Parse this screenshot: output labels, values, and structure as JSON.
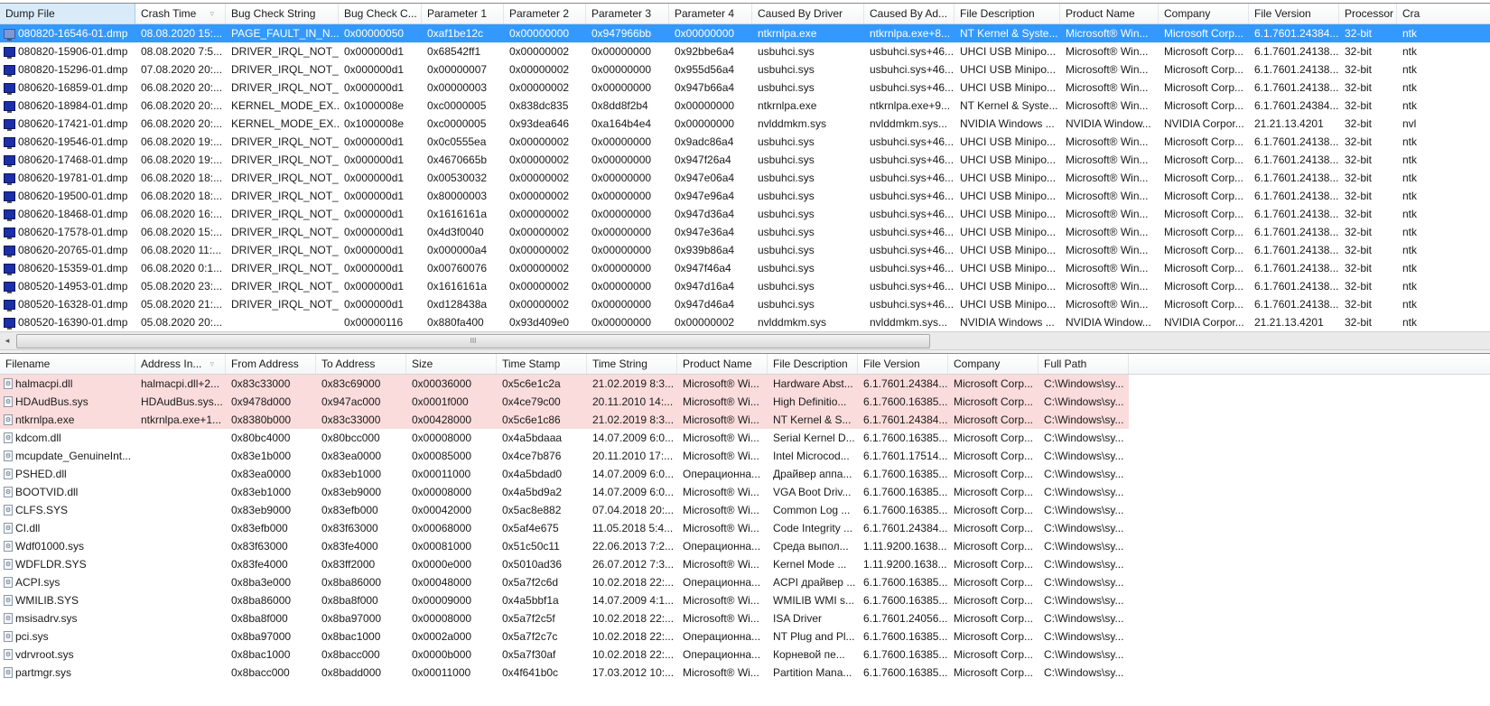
{
  "top": {
    "sort_column": "Crash Time",
    "columns": [
      "Dump File",
      "Crash Time",
      "Bug Check String",
      "Bug Check C...",
      "Parameter 1",
      "Parameter 2",
      "Parameter 3",
      "Parameter 4",
      "Caused By Driver",
      "Caused By Ad...",
      "File Description",
      "Product Name",
      "Company",
      "File Version",
      "Processor",
      "Cra"
    ],
    "selected_index": 0,
    "rows": [
      [
        "080820-16546-01.dmp",
        "08.08.2020 15:...",
        "PAGE_FAULT_IN_N...",
        "0x00000050",
        "0xaf1be12c",
        "0x00000000",
        "0x947966bb",
        "0x00000000",
        "ntkrnlpa.exe",
        "ntkrnlpa.exe+8...",
        "NT Kernel & Syste...",
        "Microsoft® Win...",
        "Microsoft Corp...",
        "6.1.7601.24384...",
        "32-bit",
        "ntk"
      ],
      [
        "080820-15906-01.dmp",
        "08.08.2020 7:5...",
        "DRIVER_IRQL_NOT_...",
        "0x000000d1",
        "0x68542ff1",
        "0x00000002",
        "0x00000000",
        "0x92bbe6a4",
        "usbuhci.sys",
        "usbuhci.sys+46...",
        "UHCI USB Minipo...",
        "Microsoft® Win...",
        "Microsoft Corp...",
        "6.1.7601.24138...",
        "32-bit",
        "ntk"
      ],
      [
        "080820-15296-01.dmp",
        "07.08.2020 20:...",
        "DRIVER_IRQL_NOT_...",
        "0x000000d1",
        "0x00000007",
        "0x00000002",
        "0x00000000",
        "0x955d56a4",
        "usbuhci.sys",
        "usbuhci.sys+46...",
        "UHCI USB Minipo...",
        "Microsoft® Win...",
        "Microsoft Corp...",
        "6.1.7601.24138...",
        "32-bit",
        "ntk"
      ],
      [
        "080620-16859-01.dmp",
        "06.08.2020 20:...",
        "DRIVER_IRQL_NOT_...",
        "0x000000d1",
        "0x00000003",
        "0x00000002",
        "0x00000000",
        "0x947b66a4",
        "usbuhci.sys",
        "usbuhci.sys+46...",
        "UHCI USB Minipo...",
        "Microsoft® Win...",
        "Microsoft Corp...",
        "6.1.7601.24138...",
        "32-bit",
        "ntk"
      ],
      [
        "080620-18984-01.dmp",
        "06.08.2020 20:...",
        "KERNEL_MODE_EX...",
        "0x1000008e",
        "0xc0000005",
        "0x838dc835",
        "0x8dd8f2b4",
        "0x00000000",
        "ntkrnlpa.exe",
        "ntkrnlpa.exe+9...",
        "NT Kernel & Syste...",
        "Microsoft® Win...",
        "Microsoft Corp...",
        "6.1.7601.24384...",
        "32-bit",
        "ntk"
      ],
      [
        "080620-17421-01.dmp",
        "06.08.2020 20:...",
        "KERNEL_MODE_EX...",
        "0x1000008e",
        "0xc0000005",
        "0x93dea646",
        "0xa164b4e4",
        "0x00000000",
        "nvlddmkm.sys",
        "nvlddmkm.sys...",
        "NVIDIA Windows ...",
        "NVIDIA Window...",
        "NVIDIA Corpor...",
        "21.21.13.4201",
        "32-bit",
        "nvl"
      ],
      [
        "080620-19546-01.dmp",
        "06.08.2020 19:...",
        "DRIVER_IRQL_NOT_...",
        "0x000000d1",
        "0x0c0555ea",
        "0x00000002",
        "0x00000000",
        "0x9adc86a4",
        "usbuhci.sys",
        "usbuhci.sys+46...",
        "UHCI USB Minipo...",
        "Microsoft® Win...",
        "Microsoft Corp...",
        "6.1.7601.24138...",
        "32-bit",
        "ntk"
      ],
      [
        "080620-17468-01.dmp",
        "06.08.2020 19:...",
        "DRIVER_IRQL_NOT_...",
        "0x000000d1",
        "0x4670665b",
        "0x00000002",
        "0x00000000",
        "0x947f26a4",
        "usbuhci.sys",
        "usbuhci.sys+46...",
        "UHCI USB Minipo...",
        "Microsoft® Win...",
        "Microsoft Corp...",
        "6.1.7601.24138...",
        "32-bit",
        "ntk"
      ],
      [
        "080620-19781-01.dmp",
        "06.08.2020 18:...",
        "DRIVER_IRQL_NOT_...",
        "0x000000d1",
        "0x00530032",
        "0x00000002",
        "0x00000000",
        "0x947e06a4",
        "usbuhci.sys",
        "usbuhci.sys+46...",
        "UHCI USB Minipo...",
        "Microsoft® Win...",
        "Microsoft Corp...",
        "6.1.7601.24138...",
        "32-bit",
        "ntk"
      ],
      [
        "080620-19500-01.dmp",
        "06.08.2020 18:...",
        "DRIVER_IRQL_NOT_...",
        "0x000000d1",
        "0x80000003",
        "0x00000002",
        "0x00000000",
        "0x947e96a4",
        "usbuhci.sys",
        "usbuhci.sys+46...",
        "UHCI USB Minipo...",
        "Microsoft® Win...",
        "Microsoft Corp...",
        "6.1.7601.24138...",
        "32-bit",
        "ntk"
      ],
      [
        "080620-18468-01.dmp",
        "06.08.2020 16:...",
        "DRIVER_IRQL_NOT_...",
        "0x000000d1",
        "0x1616161a",
        "0x00000002",
        "0x00000000",
        "0x947d36a4",
        "usbuhci.sys",
        "usbuhci.sys+46...",
        "UHCI USB Minipo...",
        "Microsoft® Win...",
        "Microsoft Corp...",
        "6.1.7601.24138...",
        "32-bit",
        "ntk"
      ],
      [
        "080620-17578-01.dmp",
        "06.08.2020 15:...",
        "DRIVER_IRQL_NOT_...",
        "0x000000d1",
        "0x4d3f0040",
        "0x00000002",
        "0x00000000",
        "0x947e36a4",
        "usbuhci.sys",
        "usbuhci.sys+46...",
        "UHCI USB Minipo...",
        "Microsoft® Win...",
        "Microsoft Corp...",
        "6.1.7601.24138...",
        "32-bit",
        "ntk"
      ],
      [
        "080620-20765-01.dmp",
        "06.08.2020 11:...",
        "DRIVER_IRQL_NOT_...",
        "0x000000d1",
        "0x000000a4",
        "0x00000002",
        "0x00000000",
        "0x939b86a4",
        "usbuhci.sys",
        "usbuhci.sys+46...",
        "UHCI USB Minipo...",
        "Microsoft® Win...",
        "Microsoft Corp...",
        "6.1.7601.24138...",
        "32-bit",
        "ntk"
      ],
      [
        "080620-15359-01.dmp",
        "06.08.2020 0:1...",
        "DRIVER_IRQL_NOT_...",
        "0x000000d1",
        "0x00760076",
        "0x00000002",
        "0x00000000",
        "0x947f46a4",
        "usbuhci.sys",
        "usbuhci.sys+46...",
        "UHCI USB Minipo...",
        "Microsoft® Win...",
        "Microsoft Corp...",
        "6.1.7601.24138...",
        "32-bit",
        "ntk"
      ],
      [
        "080520-14953-01.dmp",
        "05.08.2020 23:...",
        "DRIVER_IRQL_NOT_...",
        "0x000000d1",
        "0x1616161a",
        "0x00000002",
        "0x00000000",
        "0x947d16a4",
        "usbuhci.sys",
        "usbuhci.sys+46...",
        "UHCI USB Minipo...",
        "Microsoft® Win...",
        "Microsoft Corp...",
        "6.1.7601.24138...",
        "32-bit",
        "ntk"
      ],
      [
        "080520-16328-01.dmp",
        "05.08.2020 21:...",
        "DRIVER_IRQL_NOT_...",
        "0x000000d1",
        "0xd128438a",
        "0x00000002",
        "0x00000000",
        "0x947d46a4",
        "usbuhci.sys",
        "usbuhci.sys+46...",
        "UHCI USB Minipo...",
        "Microsoft® Win...",
        "Microsoft Corp...",
        "6.1.7601.24138...",
        "32-bit",
        "ntk"
      ],
      [
        "080520-16390-01.dmp",
        "05.08.2020 20:...",
        "",
        "0x00000116",
        "0x880fa400",
        "0x93d409e0",
        "0x00000000",
        "0x00000002",
        "nvlddmkm.sys",
        "nvlddmkm.sys...",
        "NVIDIA Windows ...",
        "NVIDIA Window...",
        "NVIDIA Corpor...",
        "21.21.13.4201",
        "32-bit",
        "ntk"
      ]
    ]
  },
  "scrollbar": {
    "left_arrow": "◂",
    "grip": "III"
  },
  "bottom": {
    "columns": [
      "Filename",
      "Address In...",
      "From Address",
      "To Address",
      "Size",
      "Time Stamp",
      "Time String",
      "Product Name",
      "File Description",
      "File Version",
      "Company",
      "Full Path"
    ],
    "highlighted_count": 3,
    "rows": [
      [
        "halmacpi.dll",
        "halmacpi.dll+2...",
        "0x83c33000",
        "0x83c69000",
        "0x00036000",
        "0x5c6e1c2a",
        "21.02.2019 8:3...",
        "Microsoft® Wi...",
        "Hardware Abst...",
        "6.1.7601.24384...",
        "Microsoft Corp...",
        "C:\\Windows\\sy..."
      ],
      [
        "HDAudBus.sys",
        "HDAudBus.sys...",
        "0x9478d000",
        "0x947ac000",
        "0x0001f000",
        "0x4ce79c00",
        "20.11.2010 14:...",
        "Microsoft® Wi...",
        "High Definitio...",
        "6.1.7600.16385...",
        "Microsoft Corp...",
        "C:\\Windows\\sy..."
      ],
      [
        "ntkrnlpa.exe",
        "ntkrnlpa.exe+1...",
        "0x8380b000",
        "0x83c33000",
        "0x00428000",
        "0x5c6e1c86",
        "21.02.2019 8:3...",
        "Microsoft® Wi...",
        "NT Kernel & S...",
        "6.1.7601.24384...",
        "Microsoft Corp...",
        "C:\\Windows\\sy..."
      ],
      [
        "kdcom.dll",
        "",
        "0x80bc4000",
        "0x80bcc000",
        "0x00008000",
        "0x4a5bdaaa",
        "14.07.2009 6:0...",
        "Microsoft® Wi...",
        "Serial Kernel D...",
        "6.1.7600.16385...",
        "Microsoft Corp...",
        "C:\\Windows\\sy..."
      ],
      [
        "mcupdate_GenuineInt...",
        "",
        "0x83e1b000",
        "0x83ea0000",
        "0x00085000",
        "0x4ce7b876",
        "20.11.2010 17:...",
        "Microsoft® Wi...",
        "Intel Microcod...",
        "6.1.7601.17514...",
        "Microsoft Corp...",
        "C:\\Windows\\sy..."
      ],
      [
        "PSHED.dll",
        "",
        "0x83ea0000",
        "0x83eb1000",
        "0x00011000",
        "0x4a5bdad0",
        "14.07.2009 6:0...",
        "Операционна...",
        "Драйвер аппа...",
        "6.1.7600.16385...",
        "Microsoft Corp...",
        "C:\\Windows\\sy..."
      ],
      [
        "BOOTVID.dll",
        "",
        "0x83eb1000",
        "0x83eb9000",
        "0x00008000",
        "0x4a5bd9a2",
        "14.07.2009 6:0...",
        "Microsoft® Wi...",
        "VGA Boot Driv...",
        "6.1.7600.16385...",
        "Microsoft Corp...",
        "C:\\Windows\\sy..."
      ],
      [
        "CLFS.SYS",
        "",
        "0x83eb9000",
        "0x83efb000",
        "0x00042000",
        "0x5ac8e882",
        "07.04.2018 20:...",
        "Microsoft® Wi...",
        "Common Log ...",
        "6.1.7600.16385...",
        "Microsoft Corp...",
        "C:\\Windows\\sy..."
      ],
      [
        "CI.dll",
        "",
        "0x83efb000",
        "0x83f63000",
        "0x00068000",
        "0x5af4e675",
        "11.05.2018 5:4...",
        "Microsoft® Wi...",
        "Code Integrity ...",
        "6.1.7601.24384...",
        "Microsoft Corp...",
        "C:\\Windows\\sy..."
      ],
      [
        "Wdf01000.sys",
        "",
        "0x83f63000",
        "0x83fe4000",
        "0x00081000",
        "0x51c50c11",
        "22.06.2013 7:2...",
        "Операционна...",
        "Среда выпол...",
        "1.11.9200.1638...",
        "Microsoft Corp...",
        "C:\\Windows\\sy..."
      ],
      [
        "WDFLDR.SYS",
        "",
        "0x83fe4000",
        "0x83ff2000",
        "0x0000e000",
        "0x5010ad36",
        "26.07.2012 7:3...",
        "Microsoft® Wi...",
        "Kernel Mode ...",
        "1.11.9200.1638...",
        "Microsoft Corp...",
        "C:\\Windows\\sy..."
      ],
      [
        "ACPI.sys",
        "",
        "0x8ba3e000",
        "0x8ba86000",
        "0x00048000",
        "0x5a7f2c6d",
        "10.02.2018 22:...",
        "Операционна...",
        "ACPI драйвер ...",
        "6.1.7600.16385...",
        "Microsoft Corp...",
        "C:\\Windows\\sy..."
      ],
      [
        "WMILIB.SYS",
        "",
        "0x8ba86000",
        "0x8ba8f000",
        "0x00009000",
        "0x4a5bbf1a",
        "14.07.2009 4:1...",
        "Microsoft® Wi...",
        "WMILIB WMI s...",
        "6.1.7600.16385...",
        "Microsoft Corp...",
        "C:\\Windows\\sy..."
      ],
      [
        "msisadrv.sys",
        "",
        "0x8ba8f000",
        "0x8ba97000",
        "0x00008000",
        "0x5a7f2c5f",
        "10.02.2018 22:...",
        "Microsoft® Wi...",
        "ISA Driver",
        "6.1.7601.24056...",
        "Microsoft Corp...",
        "C:\\Windows\\sy..."
      ],
      [
        "pci.sys",
        "",
        "0x8ba97000",
        "0x8bac1000",
        "0x0002a000",
        "0x5a7f2c7c",
        "10.02.2018 22:...",
        "Операционна...",
        "NT Plug and Pl...",
        "6.1.7600.16385...",
        "Microsoft Corp...",
        "C:\\Windows\\sy..."
      ],
      [
        "vdrvroot.sys",
        "",
        "0x8bac1000",
        "0x8bacc000",
        "0x0000b000",
        "0x5a7f30af",
        "10.02.2018 22:...",
        "Операционна...",
        "Корневой пе...",
        "6.1.7600.16385...",
        "Microsoft Corp...",
        "C:\\Windows\\sy..."
      ],
      [
        "partmgr.sys",
        "",
        "0x8bacc000",
        "0x8badd000",
        "0x00011000",
        "0x4f641b0c",
        "17.03.2012 10:...",
        "Microsoft® Wi...",
        "Partition Mana...",
        "6.1.7600.16385...",
        "Microsoft Corp...",
        "C:\\Windows\\sy..."
      ]
    ]
  },
  "colors": {
    "selection": "#3399ff",
    "highlight": "#fadcdc"
  }
}
